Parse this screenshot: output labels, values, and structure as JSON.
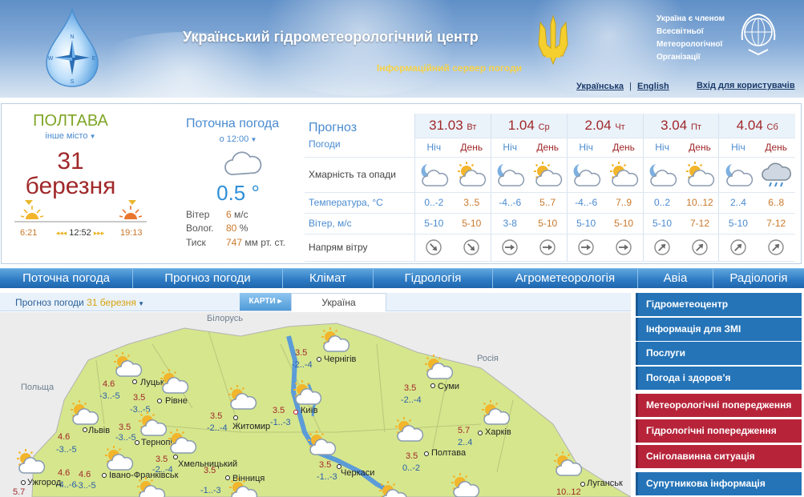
{
  "header": {
    "title": "Український гідрометеорологічний центр",
    "subtitle": "Інформаційний сервер погоди",
    "wmo_lines": [
      "Україна є членом",
      "Всесвітньої",
      "Метеорологічної",
      "Організації"
    ],
    "lang_ua": "Українська",
    "lang_separator": "|",
    "lang_en": "English",
    "login": "Вхід для користувачів",
    "compass": {
      "n": "N",
      "s": "S",
      "w": "W",
      "e": "E"
    }
  },
  "city": {
    "name": "ПОЛТАВА",
    "other": "інше місто",
    "day": "31",
    "month": "березня",
    "sunrise": "6:21",
    "noon": "12:52",
    "sunset": "19:13",
    "noon_arrows_left": "◂◂◂",
    "noon_arrows_right": "▸▸▸"
  },
  "current": {
    "title": "Поточна погода",
    "time": "о 12:00",
    "temp": "0.5 °",
    "wind_label": "Вітер",
    "wind_value": "6",
    "wind_unit": "м/с",
    "humidity_label": "Волог.",
    "humidity_value": "80",
    "humidity_unit": "%",
    "pressure_label": "Тиск",
    "pressure_value": "747",
    "pressure_unit": "мм рт. ст."
  },
  "forecast": {
    "title": "Прогноз",
    "subtitle": "Погоди",
    "row_labels": {
      "clouds": "Хмарність та опади",
      "temp": "Температура, °C",
      "wind": "Вітер, м/с",
      "dir": "Напрям вітру"
    },
    "period_night": "Ніч",
    "period_day": "День",
    "days": [
      {
        "date": "31.03",
        "dow": "Вт",
        "night_icon": "cloudy-moon-icon",
        "day_icon": "partly-cloudy-sun-icon",
        "night_temp": "0..-2",
        "day_temp": "3..5",
        "night_wind": "5-10",
        "day_wind": "5-10",
        "night_dir": "south-east-arrow-icon",
        "day_dir": "south-east-arrow-icon"
      },
      {
        "date": "1.04",
        "dow": "Ср",
        "night_icon": "cloudy-moon-icon",
        "day_icon": "partly-cloudy-sun-icon",
        "night_temp": "-4..-6",
        "day_temp": "5..7",
        "night_wind": "3-8",
        "day_wind": "5-10",
        "night_dir": "east-arrow-icon",
        "day_dir": "east-arrow-icon"
      },
      {
        "date": "2.04",
        "dow": "Чт",
        "night_icon": "cloudy-moon-icon",
        "day_icon": "partly-cloudy-sun-icon",
        "night_temp": "-4..-6",
        "day_temp": "7..9",
        "night_wind": "5-10",
        "day_wind": "5-10",
        "night_dir": "east-arrow-icon",
        "day_dir": "east-arrow-icon"
      },
      {
        "date": "3.04",
        "dow": "Пт",
        "night_icon": "cloudy-moon-icon",
        "day_icon": "partly-cloudy-sun-icon",
        "night_temp": "0..2",
        "day_temp": "10..12",
        "night_wind": "5-10",
        "day_wind": "7-12",
        "night_dir": "north-east-arrow-icon",
        "day_dir": "north-east-arrow-icon"
      },
      {
        "date": "4.04",
        "dow": "Сб",
        "night_icon": "cloudy-moon-icon",
        "day_icon": "rain-cloud-icon",
        "night_temp": "2..4",
        "day_temp": "6..8",
        "night_wind": "5-10",
        "day_wind": "7-12",
        "night_dir": "north-east-arrow-icon",
        "day_dir": "north-east-arrow-icon"
      }
    ]
  },
  "nav": [
    "Поточна погода",
    "Прогноз погоди",
    "Клімат",
    "Гідрологія",
    "Агрометеорологія",
    "Авіа",
    "Радіологія"
  ],
  "map_tabs": {
    "forecast_prefix": "Прогноз погоди",
    "forecast_date": "31 березня",
    "maps": "КАРТИ",
    "region": "Україна"
  },
  "map": {
    "neighbors": [
      "Білорусь",
      "Росія",
      "Польща"
    ],
    "cities": [
      {
        "name": "Чернігів",
        "day": "3.5",
        "night": "-2..-4"
      },
      {
        "name": "Луцьк",
        "day": "4.6",
        "night": "-3..-5"
      },
      {
        "name": "Рівне",
        "day": "3.5",
        "night": "-3..-5"
      },
      {
        "name": "Суми",
        "day": "3.5",
        "night": "-2..-4"
      },
      {
        "name": "Київ",
        "day": "3.5",
        "night": "-1..-3"
      },
      {
        "name": "Житомир",
        "day": "3.5",
        "night": "-2..-4"
      },
      {
        "name": "Львів",
        "day": "4.6",
        "night": "-3..-5"
      },
      {
        "name": "Тернопіль",
        "day": "3.5",
        "night": "-3..-5"
      },
      {
        "name": "Харків",
        "day": "5.7",
        "night": "2..4"
      },
      {
        "name": "Хмельницький",
        "day": "3.5",
        "night": "-2..-4"
      },
      {
        "name": "Полтава",
        "day": "3.5",
        "night": "0..-2"
      },
      {
        "name": "Ужгород",
        "day": "4.6",
        "night": "-4..-6"
      },
      {
        "name": "Івано-Франківськ",
        "day": "4.6",
        "night": "-3..-5"
      },
      {
        "name": "Вінниця",
        "day": "3.5",
        "night": "-1..-3"
      },
      {
        "name": "Черкаси",
        "day": "3.5",
        "night": "-1..-3"
      },
      {
        "name": "Луганськ",
        "day": "10..12",
        "night": ""
      }
    ],
    "extra_temp": "5.7"
  },
  "sidebar": [
    {
      "label": "Гідрометеоцентр",
      "style": "blue"
    },
    {
      "label": "Інформація для ЗМІ",
      "style": "blue"
    },
    {
      "label": "Послуги",
      "style": "blue"
    },
    {
      "label": "Погода і здоров’я",
      "style": "blue"
    },
    {
      "label": "Метеорологічні попередження",
      "style": "red"
    },
    {
      "label": "Гідрологічні попередження",
      "style": "red"
    },
    {
      "label": "Сніголавинна ситуація",
      "style": "red"
    },
    {
      "label": "Супутникова інформація",
      "style": "blue"
    }
  ],
  "colors": {
    "nav_blue": "#2c79c2",
    "sidebar_blue": "#2574b8",
    "sidebar_red": "#b7243a",
    "city_green": "#7fa526",
    "date_red": "#a0282a",
    "map_land": "#d6e68d"
  }
}
